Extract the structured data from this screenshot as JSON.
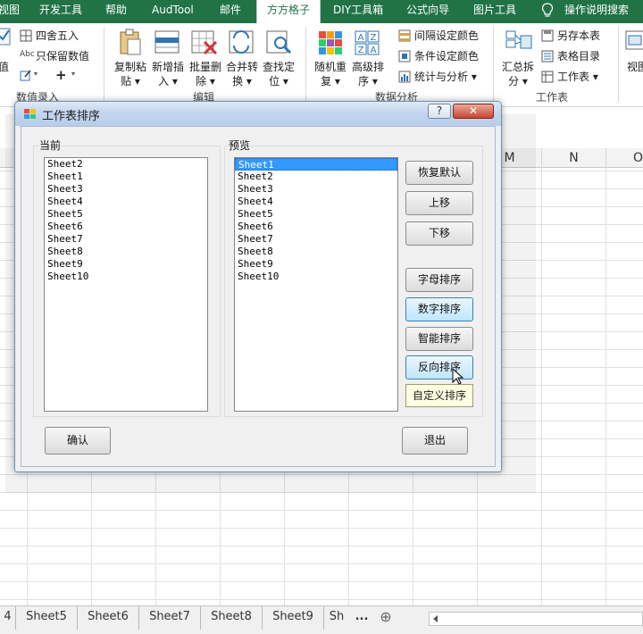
{
  "ribbon_tabs": [
    {
      "label": "视图"
    },
    {
      "label": "开发工具"
    },
    {
      "label": "帮助"
    },
    {
      "label": "AudTool"
    },
    {
      "label": "邮件"
    },
    {
      "label": "方方格子",
      "active": true
    },
    {
      "label": "DIY工具箱"
    },
    {
      "label": "公式向导"
    },
    {
      "label": "图片工具"
    },
    {
      "label": "操作说明搜索"
    }
  ],
  "ribbon": {
    "value_fragment": "值",
    "round": "四舍五入",
    "keep_values": "只保留数值",
    "copy_paste": [
      "复制粘",
      "贴"
    ],
    "add_insert": [
      "新增插",
      "入"
    ],
    "batch_delete": [
      "批量删",
      "除"
    ],
    "merge_convert": [
      "合并转",
      "换"
    ],
    "find_locate": [
      "查找定",
      "位"
    ],
    "random_repeat": [
      "随机重",
      "复"
    ],
    "advanced_sort": [
      "高级排",
      "序"
    ],
    "interval_color": "间隔设定颜色",
    "condition_color": "条件设定颜色",
    "stats_analysis": "统计与分析",
    "summary_split": [
      "汇总拆",
      "分"
    ],
    "save_sheet": "另存本表",
    "sheet_toc": "表格目录",
    "worksheet": "工作表",
    "view_fragment": "视图",
    "groups": {
      "data_entry": "数值录入",
      "edit": "编辑",
      "data_analysis": "数据分析",
      "worksheet": "工作表"
    }
  },
  "columns": [
    "M",
    "N",
    "O"
  ],
  "dialog": {
    "title": "工作表排序",
    "help_btn": "?",
    "close_btn": "✕",
    "current_label": "当前",
    "preview_label": "预览",
    "current_list": [
      "Sheet2",
      "Sheet1",
      "Sheet3",
      "Sheet4",
      "Sheet5",
      "Sheet6",
      "Sheet7",
      "Sheet8",
      "Sheet9",
      "Sheet10"
    ],
    "preview_list": [
      "Sheet1",
      "Sheet2",
      "Sheet3",
      "Sheet4",
      "Sheet5",
      "Sheet6",
      "Sheet7",
      "Sheet8",
      "Sheet9",
      "Sheet10"
    ],
    "buttons": {
      "restore": "恢复默认",
      "up": "上移",
      "down": "下移",
      "alpha_sort": "字母排序",
      "numeric_sort": "数字排序",
      "smart_sort": "智能排序",
      "reverse_sort": "反向排序",
      "confirm": "确认",
      "exit": "退出"
    },
    "tooltip": "自定义排序"
  },
  "sheet_tabs": {
    "prev_fragment": "4",
    "tabs": [
      "Sheet5",
      "Sheet6",
      "Sheet7",
      "Sheet8",
      "Sheet9"
    ],
    "partial_tab": "Sh",
    "more": "...",
    "add": "⊕"
  },
  "colors": {
    "ribbon_green": "#217346",
    "dialog_title_bar": "#c4d6ee",
    "selection_blue": "#3399ff",
    "tooltip_yellow": "#ffffe1"
  }
}
